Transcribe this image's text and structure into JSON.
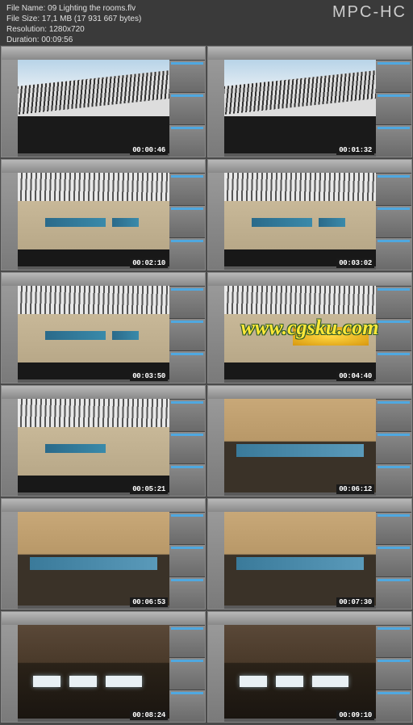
{
  "header": {
    "file_name_label": "File Name:",
    "file_name": "09 Lighting the rooms.flv",
    "file_size_label": "File Size:",
    "file_size": "17,1 MB (17 931 667 bytes)",
    "resolution_label": "Resolution:",
    "resolution": "1280x720",
    "duration_label": "Duration:",
    "duration": "00:09:56",
    "app_title": "MPC-HC"
  },
  "watermark": "www.cgsku.com",
  "thumbnails": [
    {
      "timestamp": "00:00:46",
      "scene": "exterior"
    },
    {
      "timestamp": "00:01:32",
      "scene": "exterior"
    },
    {
      "timestamp": "00:02:10",
      "scene": "facade"
    },
    {
      "timestamp": "00:03:02",
      "scene": "facade"
    },
    {
      "timestamp": "00:03:50",
      "scene": "facade"
    },
    {
      "timestamp": "00:04:40",
      "scene": "facade-glow"
    },
    {
      "timestamp": "00:05:21",
      "scene": "facade"
    },
    {
      "timestamp": "00:06:12",
      "scene": "wood"
    },
    {
      "timestamp": "00:06:53",
      "scene": "wood"
    },
    {
      "timestamp": "00:07:30",
      "scene": "wood"
    },
    {
      "timestamp": "00:08:24",
      "scene": "dark"
    },
    {
      "timestamp": "00:09:10",
      "scene": "dark"
    }
  ]
}
